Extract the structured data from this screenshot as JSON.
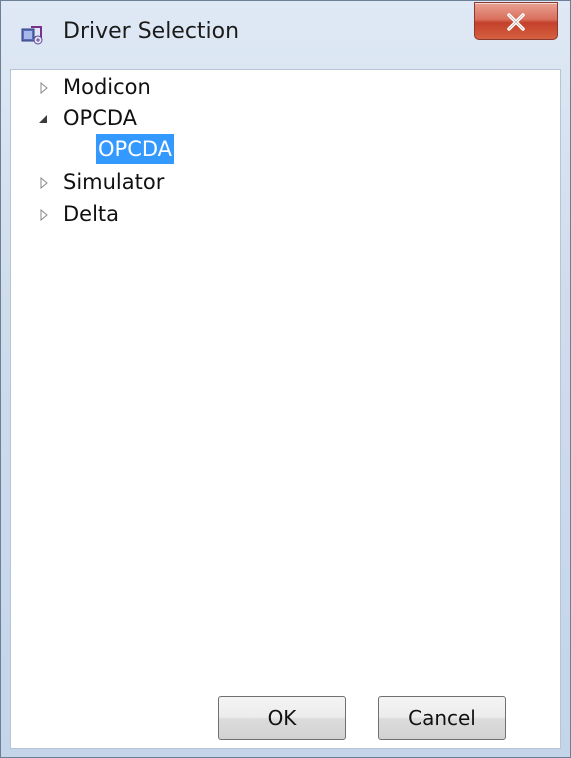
{
  "window": {
    "title": "Driver Selection",
    "icon": "driver-app-icon",
    "close_icon": "close-icon"
  },
  "tree": {
    "nodes": [
      {
        "label": "Modicon",
        "expanded": false,
        "selected": false
      },
      {
        "label": "OPCDA",
        "expanded": true,
        "selected": false,
        "children": [
          {
            "label": "OPCDA",
            "selected": true
          }
        ]
      },
      {
        "label": "Simulator",
        "expanded": false,
        "selected": false
      },
      {
        "label": "Delta",
        "expanded": false,
        "selected": false
      }
    ]
  },
  "buttons": {
    "ok_label": "OK",
    "cancel_label": "Cancel"
  },
  "colors": {
    "selection": "#3399ff",
    "close_button": "#c4412c"
  }
}
